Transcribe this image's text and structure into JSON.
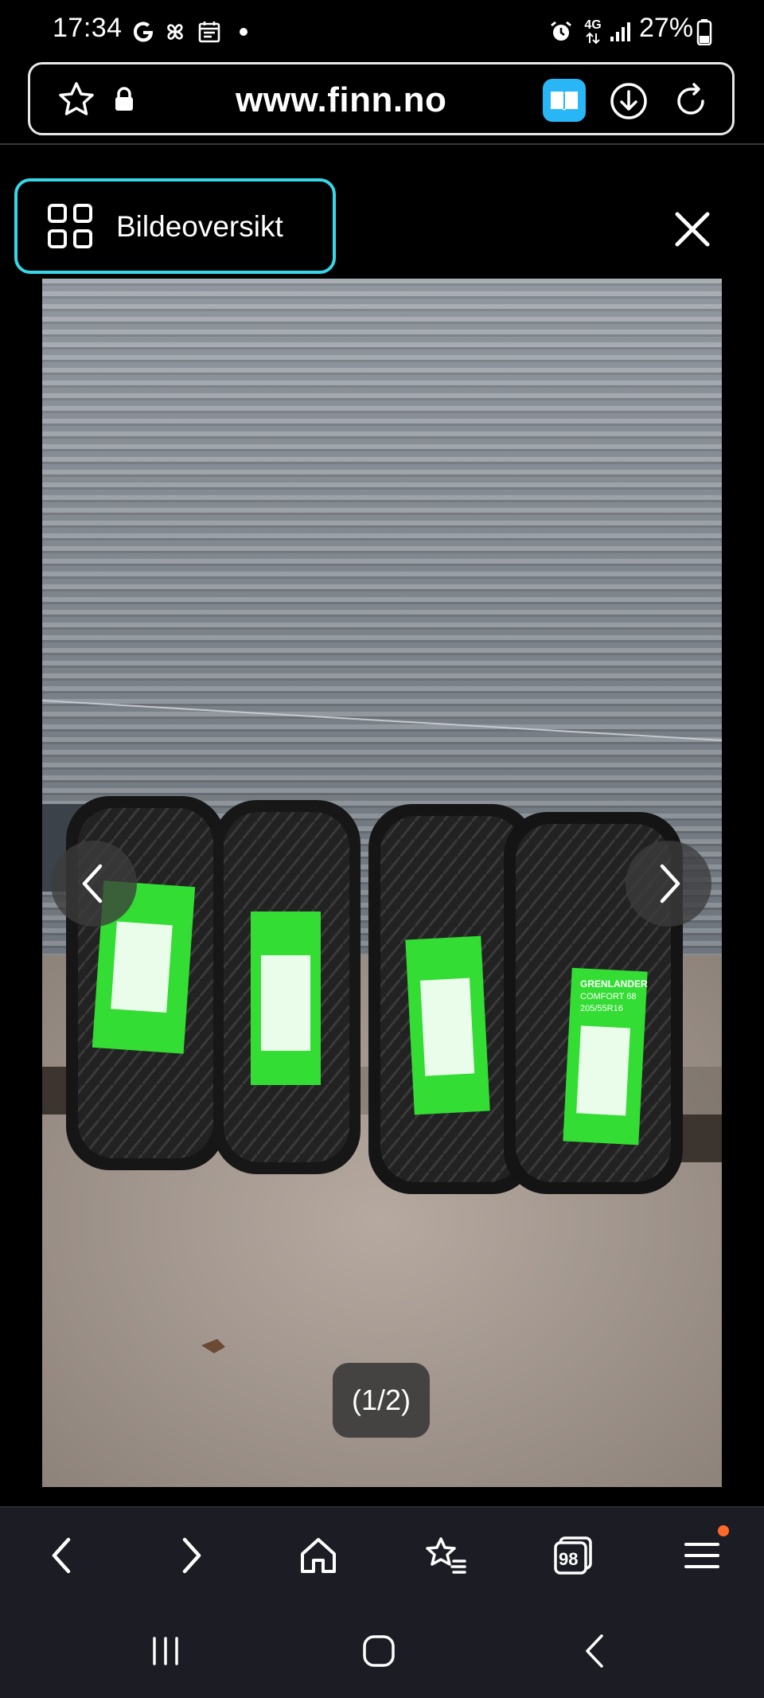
{
  "status_bar": {
    "time": "17:34",
    "left_icons": [
      "google-icon",
      "pinwheel-icon",
      "calendar-icon",
      "dot-icon"
    ],
    "right_icons": [
      "alarm-icon",
      "4g-icon",
      "signal-icon"
    ],
    "network": "4G",
    "battery_percent": "27%"
  },
  "browser": {
    "url": "www.finn.no",
    "reader_mode_color": "#29b6f6"
  },
  "gallery": {
    "overview_label": "Bildeoversikt",
    "counter": "(1/2)",
    "accent_color": "#38d6e6",
    "photo": {
      "label_brand": "GRENLANDER",
      "label_model": "COMFORT 68",
      "label_size": "205/55R16",
      "label_color": "#33dd33"
    }
  },
  "toolbar": {
    "tabs_count": "98",
    "menu_badge_color": "#ff6a2a"
  }
}
